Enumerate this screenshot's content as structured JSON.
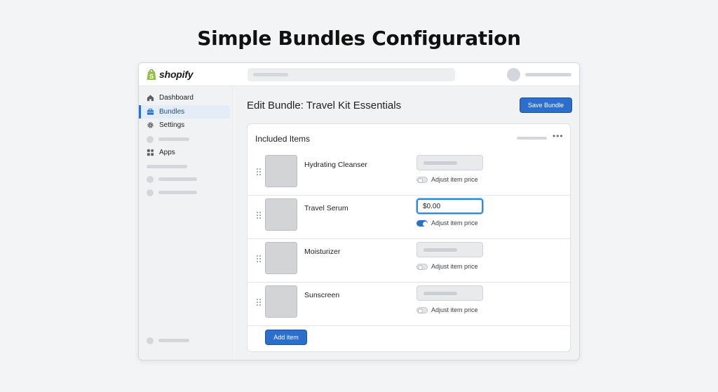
{
  "heading": "Simple Bundles Configuration",
  "app": {
    "brand": "shopify",
    "brand_color": "#95bf47"
  },
  "sidebar": {
    "items": [
      {
        "label": "Dashboard",
        "icon": "home-icon"
      },
      {
        "label": "Bundles",
        "icon": "bundle-icon",
        "active": true
      },
      {
        "label": "Settings",
        "icon": "gear-icon"
      },
      {
        "label": "Apps",
        "icon": "apps-icon"
      }
    ]
  },
  "main": {
    "title": "Edit Bundle: Travel Kit Essentials",
    "save_label": "Save Bundle",
    "card": {
      "title": "Included Items",
      "more": "•••",
      "items": [
        {
          "name": "Hydrating Cleanser",
          "price": "",
          "adjust_label": "Adjust item price",
          "adjust_on": false
        },
        {
          "name": "Travel Serum",
          "price": "$0.00",
          "adjust_label": "Adjust item price",
          "adjust_on": true
        },
        {
          "name": "Moisturizer",
          "price": "",
          "adjust_label": "Adjust item price",
          "adjust_on": false
        },
        {
          "name": "Sunscreen",
          "price": "",
          "adjust_label": "Adjust item price",
          "adjust_on": false
        }
      ],
      "add_label": "Add item"
    }
  },
  "colors": {
    "primary": "#2c6ecb",
    "focus": "#2d8be0"
  }
}
